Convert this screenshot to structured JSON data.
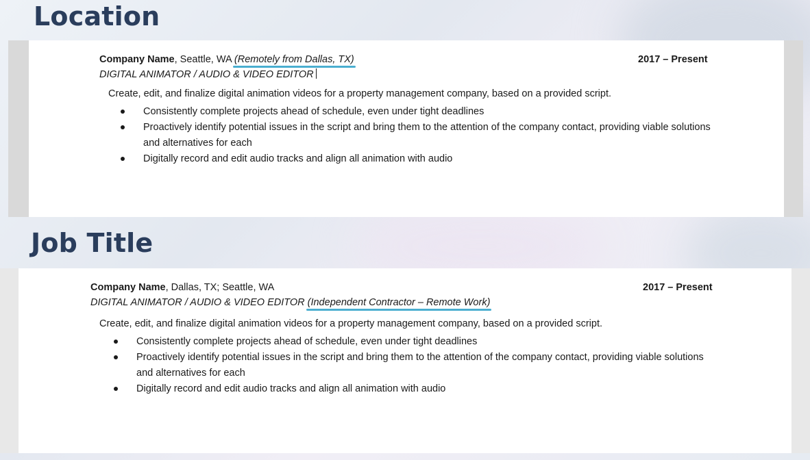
{
  "sections": [
    {
      "heading": "Location",
      "company_name": "Company Name",
      "company_location": ", Seattle, WA ",
      "location_note": "(Remotely from Dallas, TX)",
      "job_title": "DIGITAL ANIMATOR / AUDIO & VIDEO EDITOR",
      "title_note": "",
      "dates": "2017 – Present",
      "summary": "Create, edit, and finalize digital animation videos for a property management company, based on a provided script.",
      "bullets": [
        "Consistently complete projects ahead of schedule, even under tight deadlines",
        "Proactively identify potential issues in the script and bring them to the attention of the company contact, providing viable solutions and alternatives for each",
        "Digitally record and edit audio tracks and align all animation with audio"
      ]
    },
    {
      "heading": "Job Title",
      "company_name": "Company Name",
      "company_location": ", Dallas, TX; Seattle, WA",
      "location_note": "",
      "job_title": "DIGITAL ANIMATOR / AUDIO & VIDEO EDITOR ",
      "title_note": "(Independent Contractor – Remote Work)",
      "dates": "2017 – Present",
      "summary": "Create, edit, and finalize digital animation videos for a property management company, based on a provided script.",
      "bullets": [
        "Consistently complete projects ahead of schedule, even under tight deadlines",
        "Proactively identify potential issues in the script and bring them to the attention of the company contact, providing viable solutions and alternatives for each",
        "Digitally record and edit audio tracks and align all animation with audio"
      ]
    }
  ],
  "colors": {
    "heading": "#2a3d5c",
    "highlight_underline": "#4aaed0",
    "page": "#ffffff"
  }
}
